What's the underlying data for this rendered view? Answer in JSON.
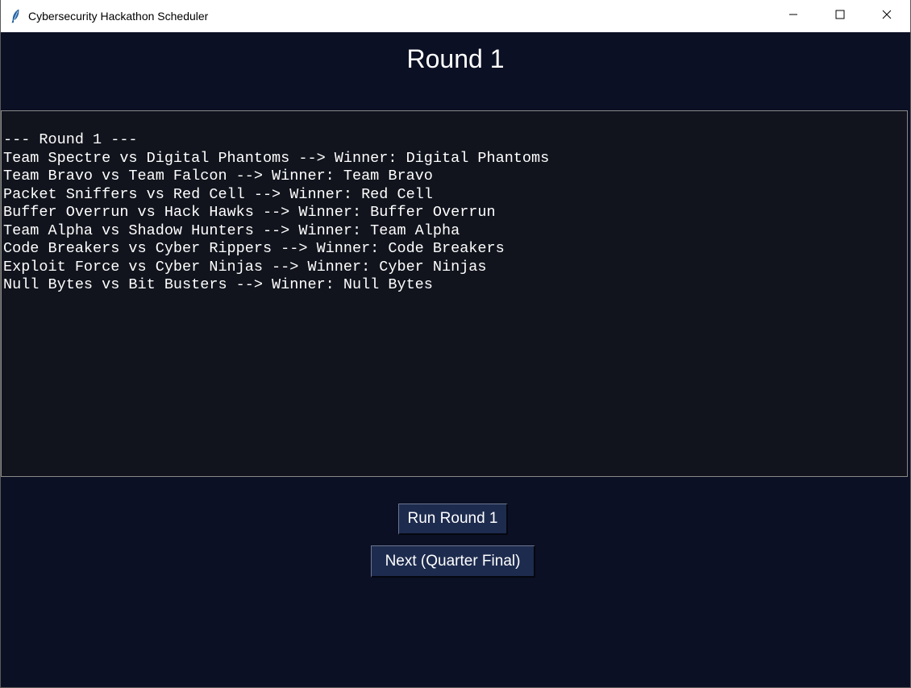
{
  "window": {
    "title": "Cybersecurity Hackathon Scheduler",
    "controls": {
      "minimize_icon": "minimize-icon",
      "maximize_icon": "maximize-icon",
      "close_icon": "close-icon"
    }
  },
  "header": {
    "title": "Round 1"
  },
  "output": {
    "lines": [
      "--- Round 1 ---",
      "Team Spectre vs Digital Phantoms --> Winner: Digital Phantoms",
      "Team Bravo vs Team Falcon --> Winner: Team Bravo",
      "Packet Sniffers vs Red Cell --> Winner: Red Cell",
      "Buffer Overrun vs Hack Hawks --> Winner: Buffer Overrun",
      "Team Alpha vs Shadow Hunters --> Winner: Team Alpha",
      "Code Breakers vs Cyber Rippers --> Winner: Code Breakers",
      "Exploit Force vs Cyber Ninjas --> Winner: Cyber Ninjas",
      "Null Bytes vs Bit Busters --> Winner: Null Bytes"
    ]
  },
  "actions": {
    "run_label": "Run Round 1",
    "next_label": "Next (Quarter Final)"
  },
  "colors": {
    "background": "#0b1024",
    "output_background": "#11141d",
    "button_background": "#1d2b4e",
    "text": "#ffffff"
  }
}
